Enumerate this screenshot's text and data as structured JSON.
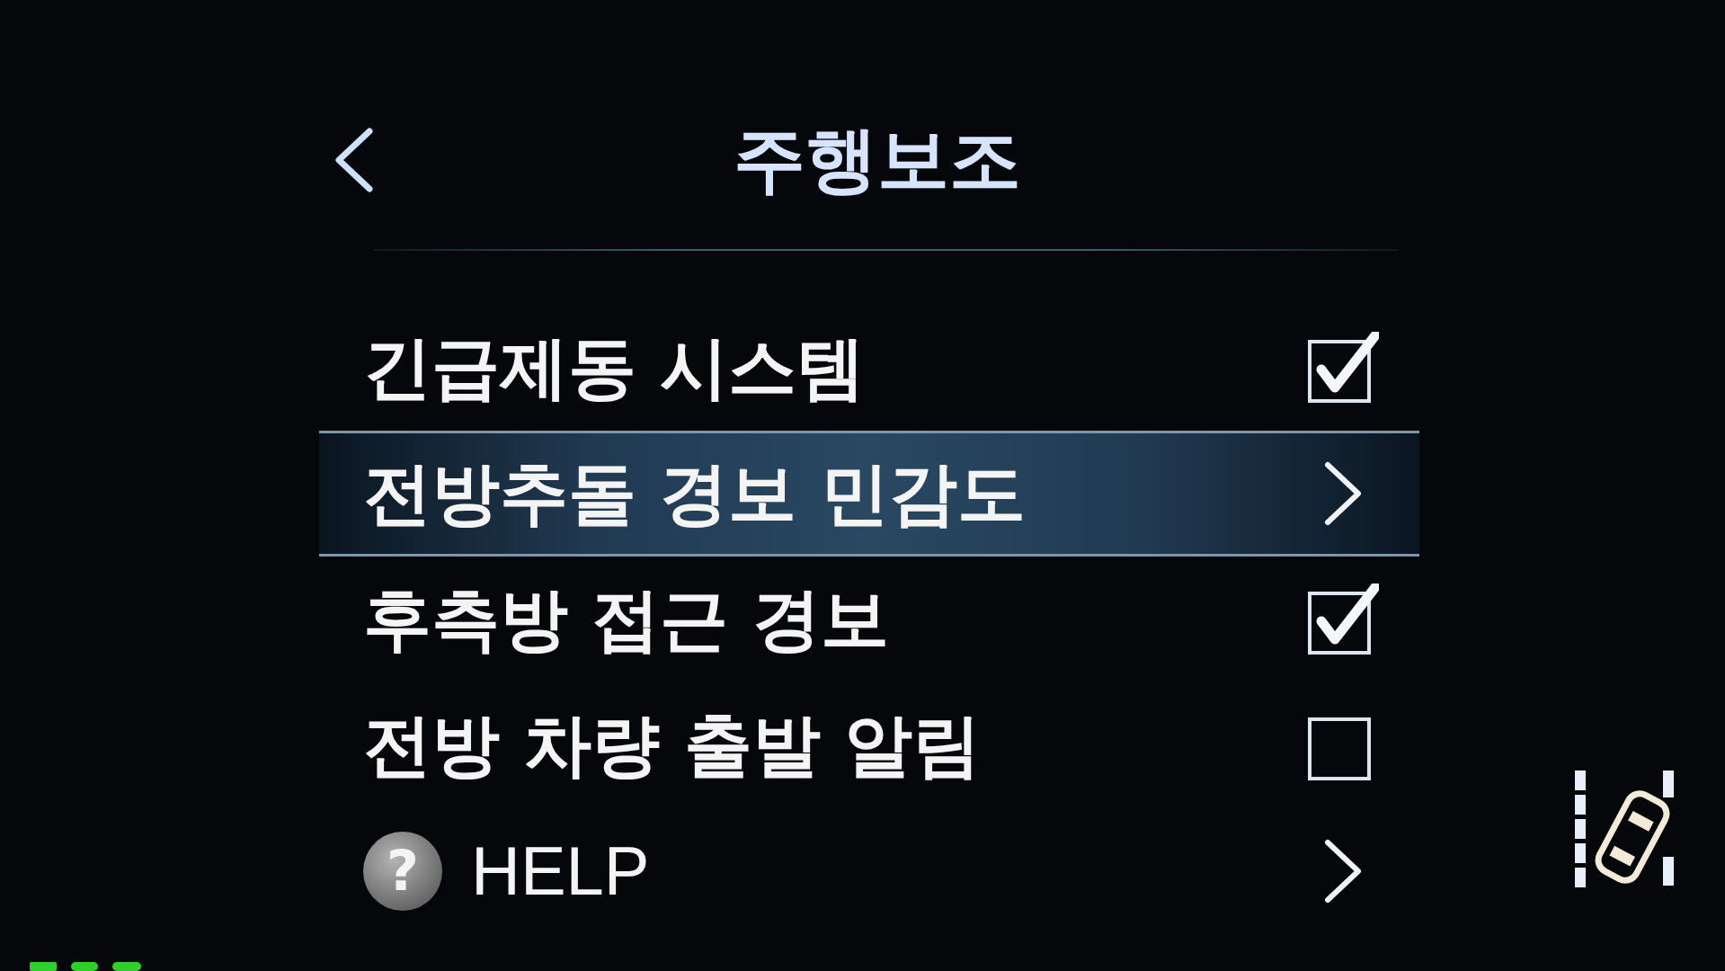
{
  "header": {
    "title": "주행보조"
  },
  "menu": {
    "items": [
      {
        "kind": "checkbox",
        "label": "긴급제동 시스템",
        "checked": true,
        "selected": false
      },
      {
        "kind": "submenu",
        "label": "전방추돌 경보 민감도",
        "selected": true
      },
      {
        "kind": "checkbox",
        "label": "후측방 접근 경보",
        "checked": true,
        "selected": false
      },
      {
        "kind": "checkbox",
        "label": "전방 차량 출발 알림",
        "checked": false,
        "selected": false
      },
      {
        "kind": "help",
        "icon": "?",
        "label": "HELP",
        "selected": false
      }
    ]
  }
}
